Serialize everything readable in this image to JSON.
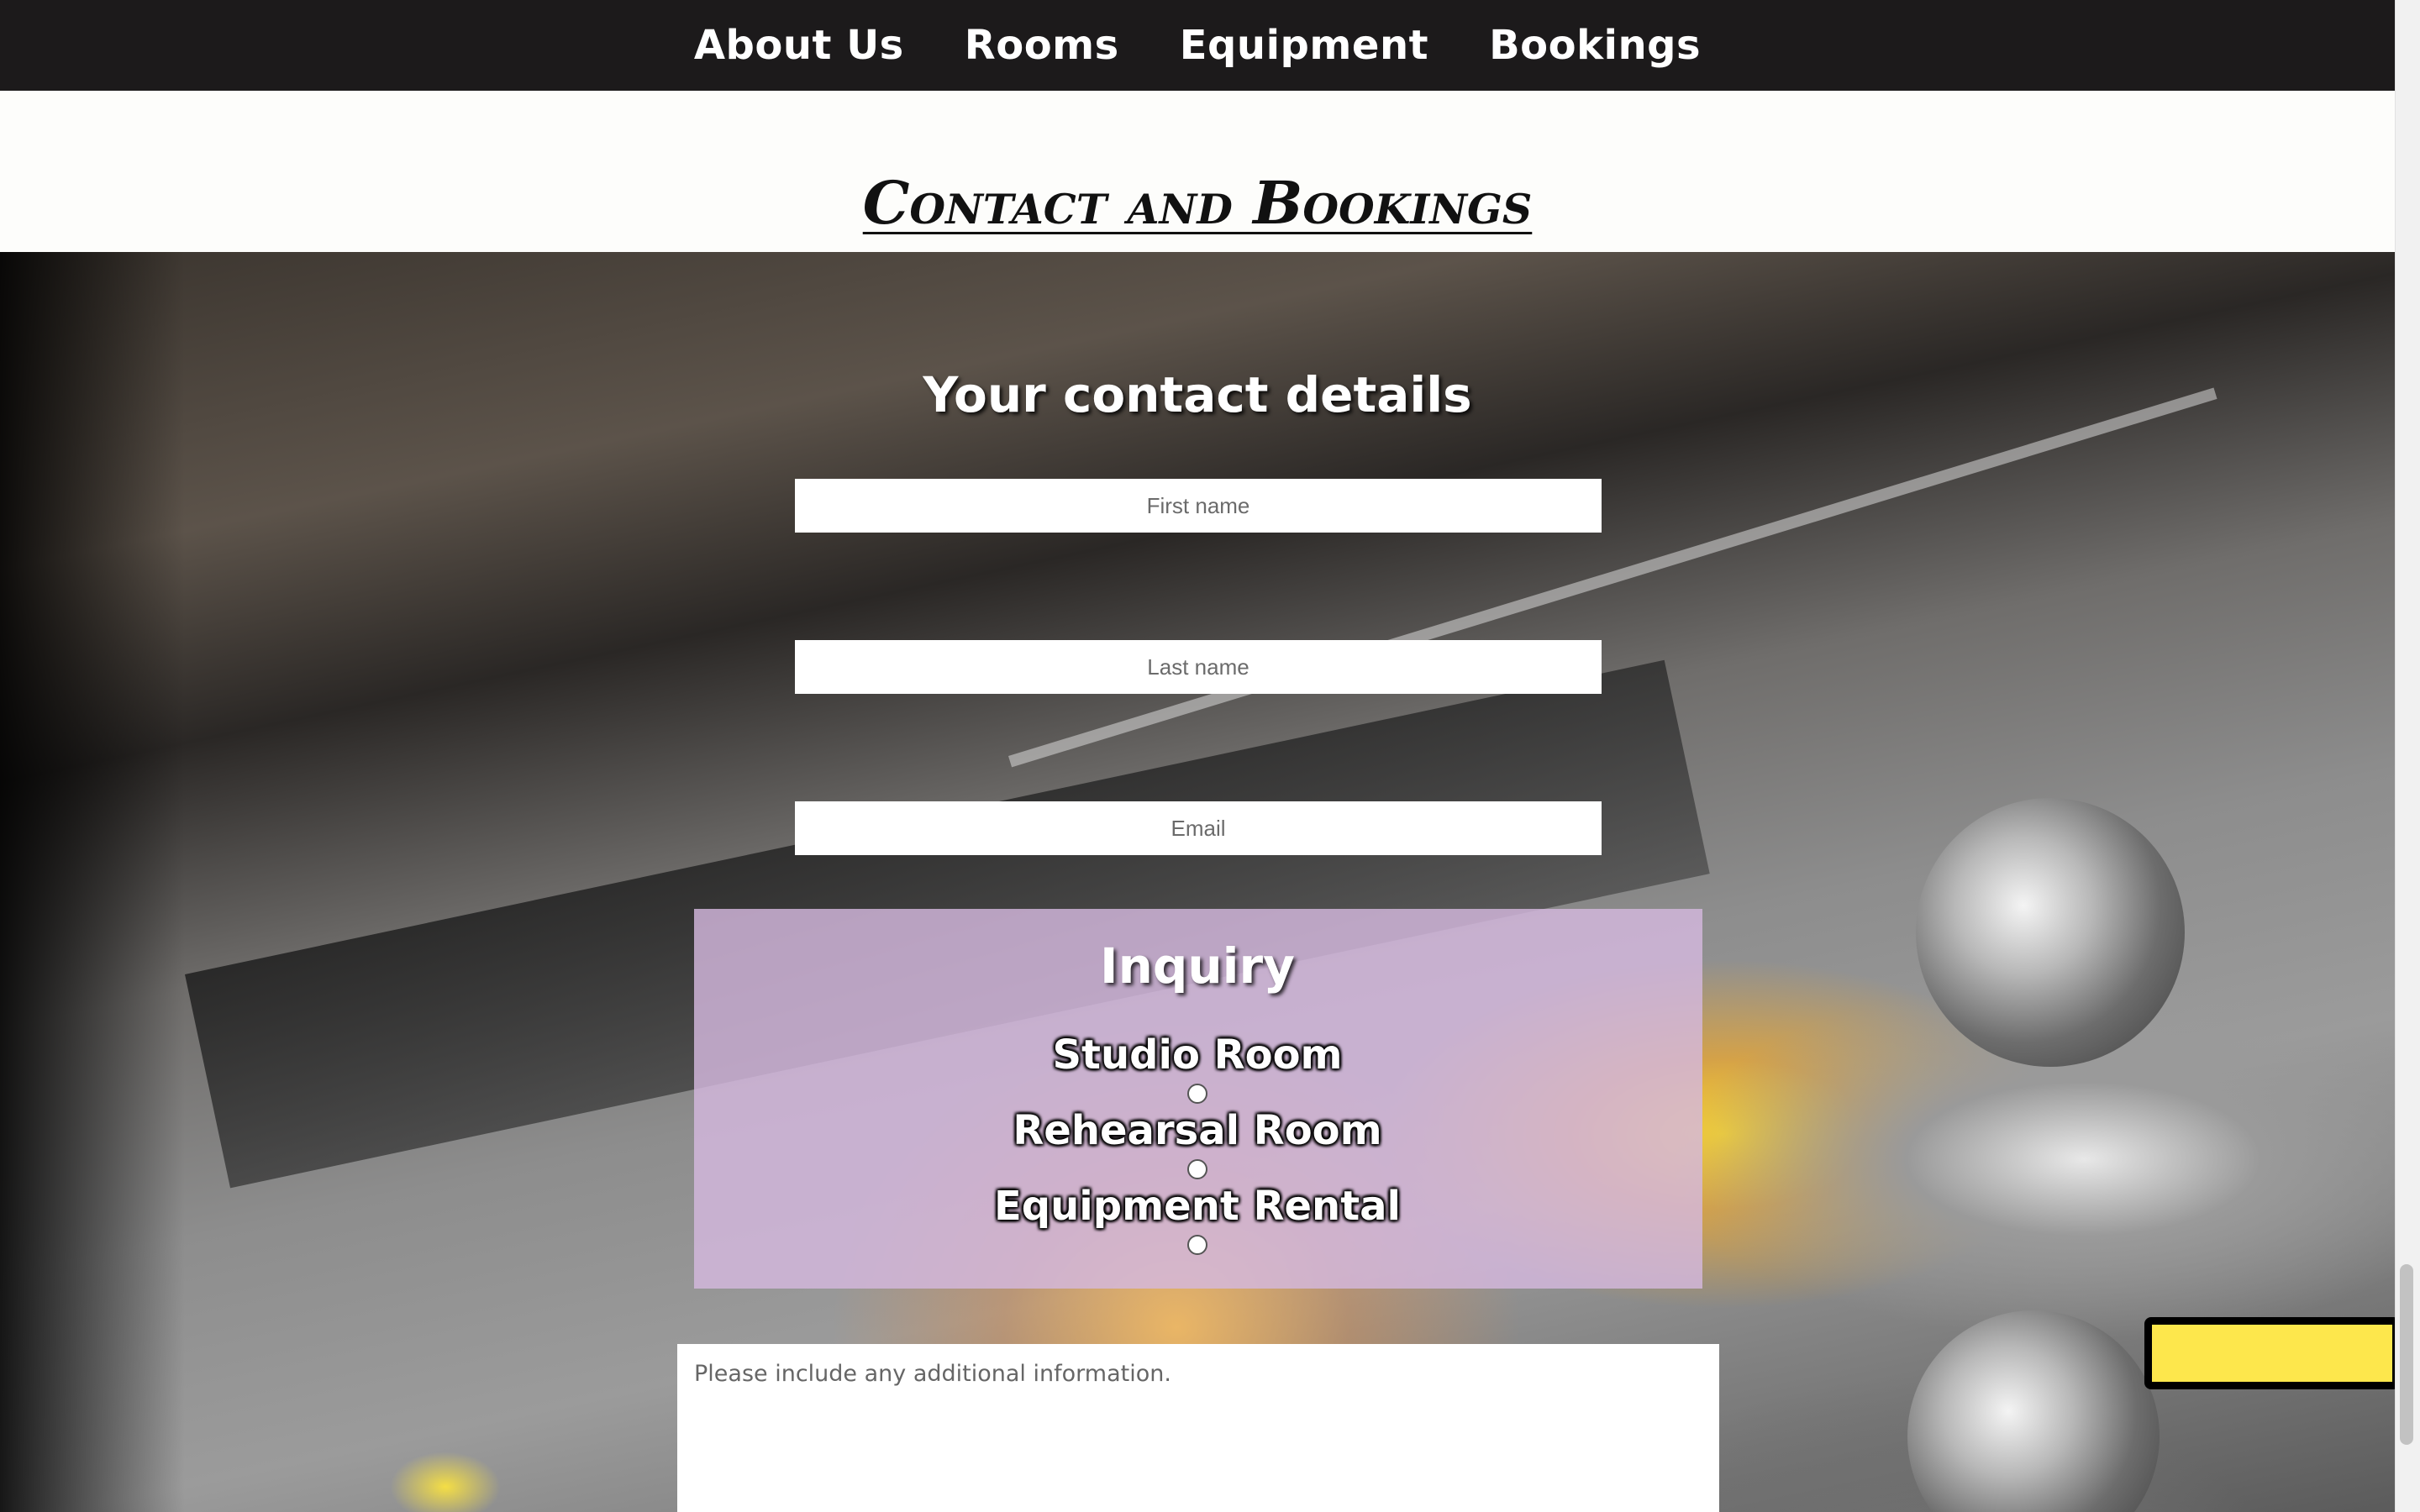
{
  "nav": {
    "items": [
      {
        "label": "About Us"
      },
      {
        "label": "Rooms"
      },
      {
        "label": "Equipment"
      },
      {
        "label": "Bookings"
      }
    ]
  },
  "page": {
    "title": "Contact and Bookings"
  },
  "contact": {
    "heading": "Your contact details",
    "first_name_placeholder": "First name",
    "last_name_placeholder": "Last name",
    "email_placeholder": "Email"
  },
  "inquiry": {
    "heading": "Inquiry",
    "options": [
      {
        "label": "Studio Room"
      },
      {
        "label": "Rehearsal Room"
      },
      {
        "label": "Equipment Rental"
      }
    ]
  },
  "message": {
    "placeholder": "Please include any additional information."
  },
  "colors": {
    "nav_background": "#1c1a1b",
    "inquiry_panel": "#d4b8de",
    "accent_yellow": "#fde74c"
  }
}
